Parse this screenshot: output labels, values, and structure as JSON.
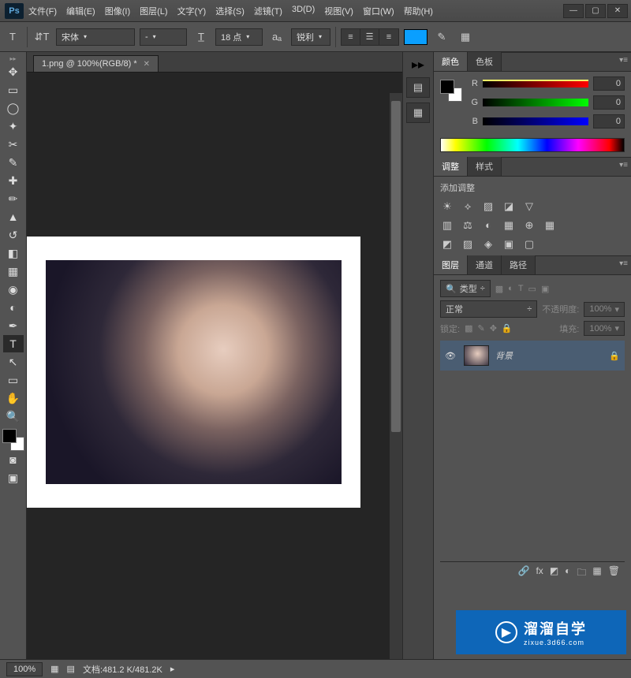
{
  "title_bar": {
    "app": "Ps",
    "menu": [
      "文件(F)",
      "编辑(E)",
      "图像(I)",
      "图层(L)",
      "文字(Y)",
      "选择(S)",
      "滤镜(T)",
      "3D(D)",
      "视图(V)",
      "窗口(W)",
      "帮助(H)"
    ]
  },
  "options_bar": {
    "tool_glyph": "T",
    "orient_glyph": "⇵T",
    "font_family": "宋体",
    "font_style": "-",
    "size_glyph": "T̲",
    "font_size": "18 点",
    "aa_glyph": "aₐ",
    "aa_mode": "锐利",
    "color": "#0a9fff"
  },
  "doc_tab": {
    "label": "1.png @ 100%(RGB/8) *"
  },
  "status": {
    "zoom": "100%",
    "doc_label": "文档:",
    "doc_value": "481.2 K/481.2K"
  },
  "color_panel": {
    "tabs": [
      "颜色",
      "色板"
    ],
    "r_label": "R",
    "r_val": "0",
    "g_label": "G",
    "g_val": "0",
    "b_label": "B",
    "b_val": "0"
  },
  "adjust_panel": {
    "tabs": [
      "调整",
      "样式"
    ],
    "heading": "添加调整",
    "row1": [
      "☀",
      "⟡",
      "▨",
      "◪",
      "▽"
    ],
    "row2": [
      "▥",
      "⚖",
      "◐",
      "▦",
      "⊕",
      "▦"
    ],
    "row3": [
      "◩",
      "▨",
      "◈",
      "▣",
      "▢"
    ]
  },
  "layers_panel": {
    "tabs": [
      "图层",
      "通道",
      "路径"
    ],
    "filter_kind": "类型",
    "blend_mode": "正常",
    "opacity_label": "不透明度:",
    "opacity_value": "100%",
    "lock_label": "锁定:",
    "fill_label": "填充:",
    "fill_value": "100%",
    "layer_name": "背景"
  },
  "watermark": {
    "title": "溜溜自学",
    "sub": "zixue.3d66.com"
  }
}
